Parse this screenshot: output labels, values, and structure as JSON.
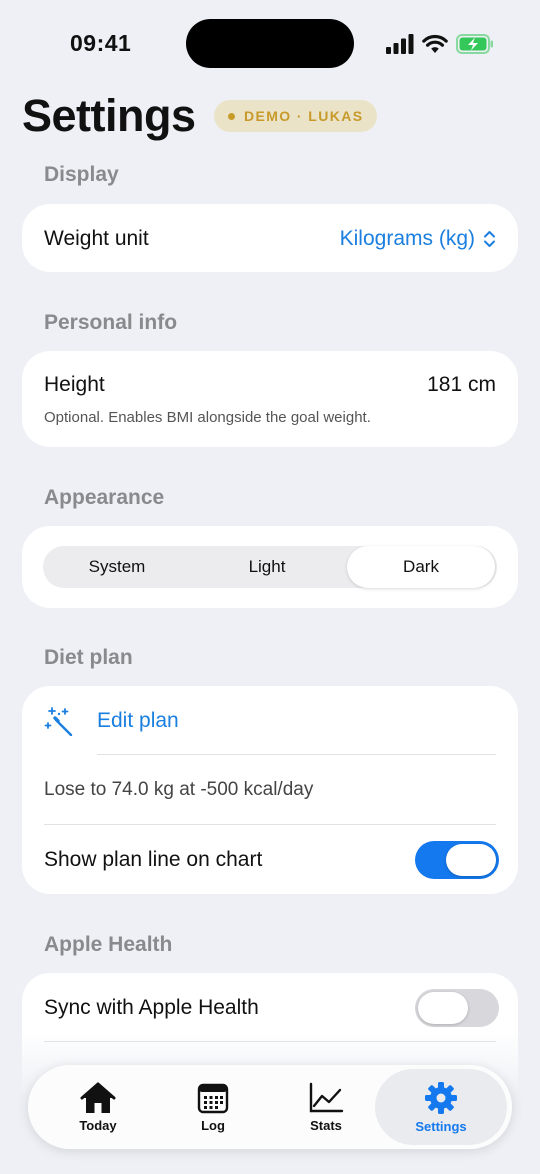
{
  "status_bar": {
    "time": "09:41",
    "icons": [
      "signal-icon",
      "wifi-icon",
      "battery-charging-icon"
    ],
    "battery_color": "#34c759"
  },
  "header": {
    "title": "Settings",
    "badge": "DEMO · LUKAS",
    "badge_color": "#c79a2a"
  },
  "display": {
    "section_label": "Display",
    "weight_unit_label": "Weight unit",
    "weight_unit_value": "Kilograms (kg)",
    "weight_unit_icon": "chevron-up-down-icon"
  },
  "personal_info": {
    "section_label": "Personal info",
    "height_label": "Height",
    "height_value": "181 cm",
    "height_caption": "Optional. Enables BMI alongside the goal weight."
  },
  "appearance": {
    "section_label": "Appearance",
    "options": [
      "System",
      "Light",
      "Dark"
    ],
    "selected": "Dark"
  },
  "diet_plan": {
    "section_label": "Diet plan",
    "edit_label": "Edit plan",
    "edit_icon": "magic-wand-icon",
    "summary": "Lose to 74.0 kg at -500 kcal/day",
    "plan_line_label": "Show plan line on chart",
    "plan_line_on": true
  },
  "apple_health": {
    "section_label": "Apple Health",
    "sync_label": "Sync with Apple Health",
    "sync_on": false
  },
  "tab_bar": {
    "tabs": [
      {
        "label": "Today",
        "icon": "house-icon"
      },
      {
        "label": "Log",
        "icon": "calendar-icon"
      },
      {
        "label": "Stats",
        "icon": "chart-line-icon"
      },
      {
        "label": "Settings",
        "icon": "gear-icon"
      }
    ],
    "selected": "Settings",
    "accent": "#1479ee"
  }
}
